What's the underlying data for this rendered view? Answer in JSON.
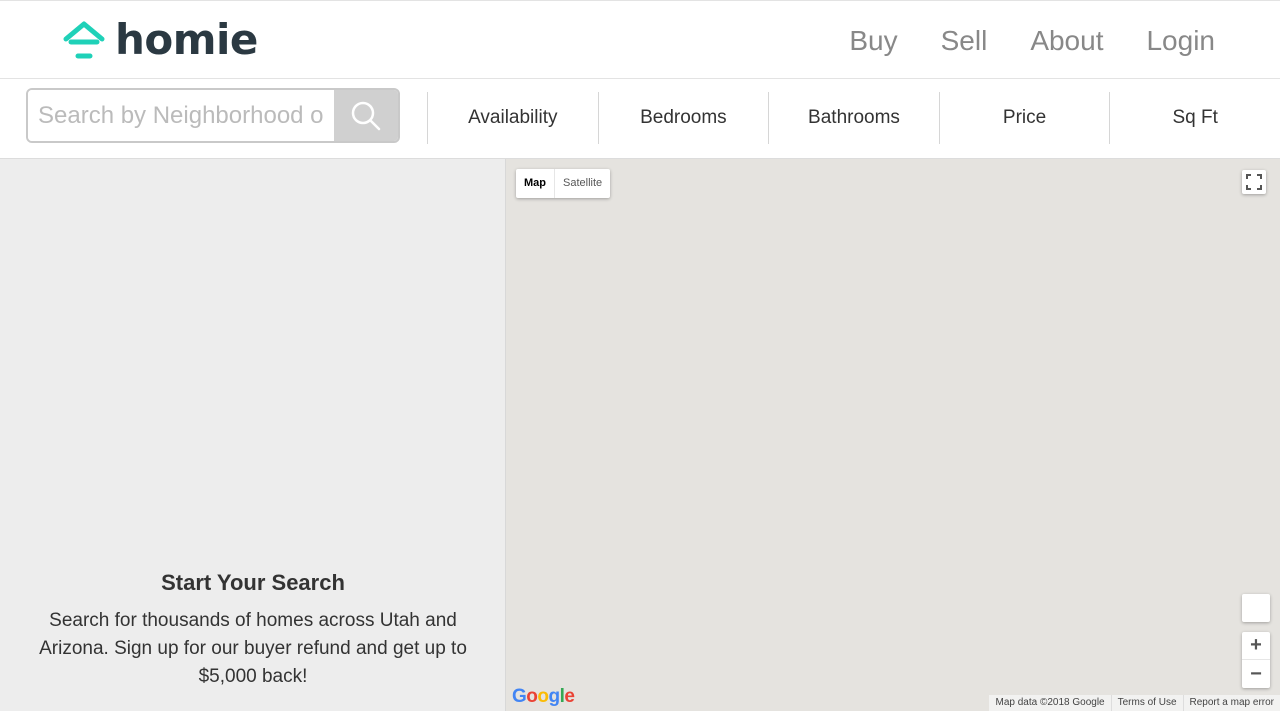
{
  "brand": {
    "name": "homie",
    "accent": "#1fd1b8",
    "text_color": "#2b3942"
  },
  "nav": {
    "items": [
      "Buy",
      "Sell",
      "About",
      "Login"
    ]
  },
  "search": {
    "placeholder": "Search by Neighborhood or"
  },
  "filters": [
    "Availability",
    "Bedrooms",
    "Bathrooms",
    "Price",
    "Sq Ft"
  ],
  "results": {
    "title": "Start Your Search",
    "description": "Search for thousands of homes across Utah and Arizona. Sign up for our buyer refund and get up to $5,000 back!"
  },
  "map": {
    "type_controls": {
      "map": "Map",
      "satellite": "Satellite"
    },
    "zoom_in": "+",
    "zoom_out": "−",
    "google_logo": "Google",
    "attribution": {
      "data": "Map data ©2018 Google",
      "terms": "Terms of Use",
      "report": "Report a map error"
    },
    "background": "#e5e3df"
  }
}
